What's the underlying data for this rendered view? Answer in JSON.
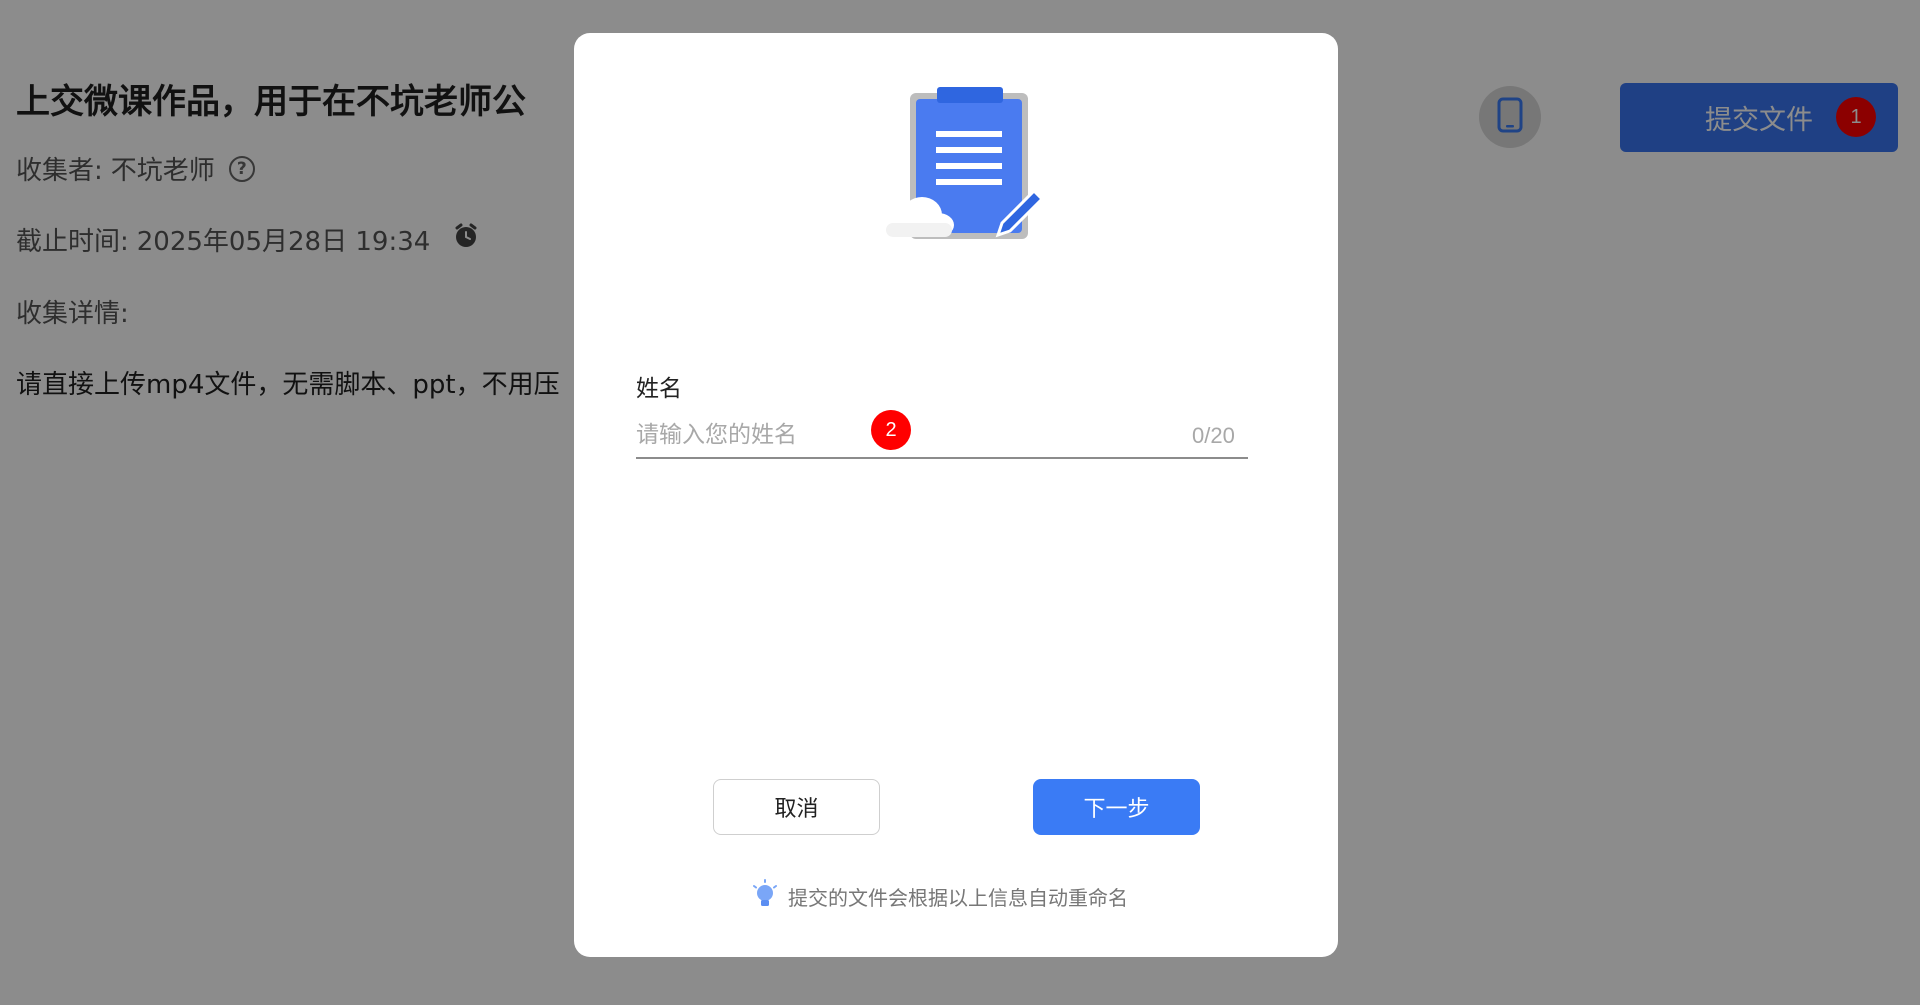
{
  "page": {
    "title": "上交微课作品，用于在不坑老师公",
    "collector_label": "收集者:",
    "collector_name": "不坑老师",
    "deadline_label": "截止时间:",
    "deadline_value": "2025年05月28日 19:34",
    "details_label": "收集详情:",
    "description": "请直接上传mp4文件，无需脚本、ppt，不用压"
  },
  "header": {
    "submit_label": "提交文件",
    "submit_badge": "1"
  },
  "modal": {
    "field_label": "姓名",
    "name_placeholder": "请输入您的姓名",
    "char_count": "0/20",
    "input_badge": "2",
    "cancel_label": "取消",
    "next_label": "下一步",
    "tip_text": "提交的文件会根据以上信息自动重命名"
  },
  "colors": {
    "primary": "#3a7bf5",
    "badge": "#ff0000",
    "overlay": "rgba(0,0,0,0.45)"
  },
  "icons": {
    "help": "question-circle-icon",
    "alarm": "alarm-clock-icon",
    "phone": "mobile-phone-icon",
    "tip": "lightbulb-icon",
    "illustration": "clipboard-edit-illustration"
  }
}
